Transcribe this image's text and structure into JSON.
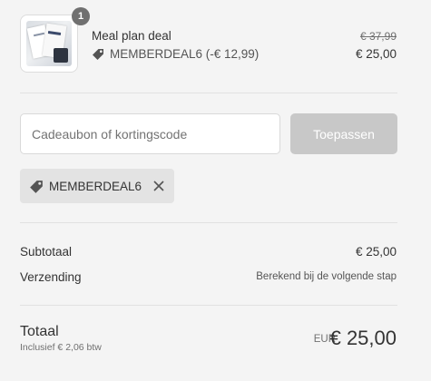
{
  "product": {
    "title": "Meal plan deal",
    "quantity": "1",
    "discount_text": "MEMBERDEAL6 (-€ 12,99)",
    "original_price": "€ 37,99",
    "price": "€ 25,00",
    "image_icon": "product-thumbnail"
  },
  "discount_form": {
    "placeholder": "Cadeaubon of kortingscode",
    "apply_label": "Toepassen"
  },
  "applied_code": {
    "code": "MEMBERDEAL6",
    "icon": "tag-icon",
    "remove_icon": "close-icon"
  },
  "totals": {
    "subtotal_label": "Subtotaal",
    "subtotal_value": "€ 25,00",
    "shipping_label": "Verzending",
    "shipping_value": "Berekend bij de volgende stap",
    "total_label": "Totaal",
    "tax_note": "Inclusief € 2,06 btw",
    "currency": "EUR",
    "total_value": "€ 25,00"
  },
  "colors": {
    "background": "#f4f4f4",
    "button_disabled": "#c8c8c8",
    "chip_background": "#e3e3e3",
    "badge": "#707070"
  }
}
